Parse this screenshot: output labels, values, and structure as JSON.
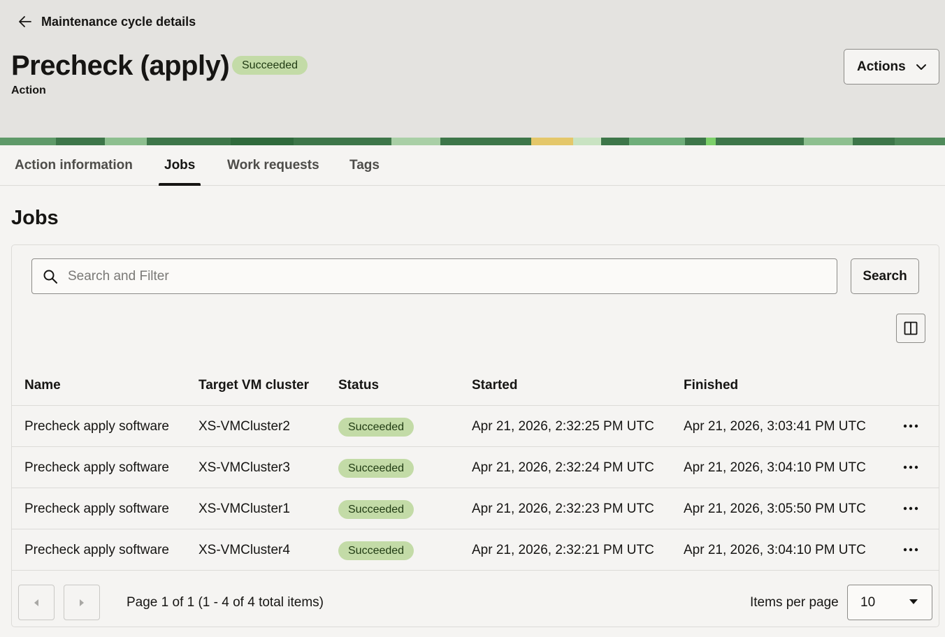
{
  "header": {
    "back_label": "Maintenance cycle details",
    "title": "Precheck (apply)",
    "status": "Succeeded",
    "subtitle": "Action",
    "actions_label": "Actions"
  },
  "tabs": [
    {
      "label": "Action information",
      "active": false
    },
    {
      "label": "Jobs",
      "active": true
    },
    {
      "label": "Work requests",
      "active": false
    },
    {
      "label": "Tags",
      "active": false
    }
  ],
  "section_title": "Jobs",
  "search": {
    "placeholder": "Search and Filter",
    "value": "",
    "button_label": "Search"
  },
  "table": {
    "columns": [
      "Name",
      "Target VM cluster",
      "Status",
      "Started",
      "Finished"
    ],
    "rows": [
      {
        "name": "Precheck apply software",
        "target": "XS-VMCluster2",
        "status": "Succeeded",
        "started": "Apr 21, 2026, 2:32:25 PM UTC",
        "finished": "Apr 21, 2026, 3:03:41 PM UTC"
      },
      {
        "name": "Precheck apply software",
        "target": "XS-VMCluster3",
        "status": "Succeeded",
        "started": "Apr 21, 2026, 2:32:24 PM UTC",
        "finished": "Apr 21, 2026, 3:04:10 PM UTC"
      },
      {
        "name": "Precheck apply software",
        "target": "XS-VMCluster1",
        "status": "Succeeded",
        "started": "Apr 21, 2026, 2:32:23 PM UTC",
        "finished": "Apr 21, 2026, 3:05:50 PM UTC"
      },
      {
        "name": "Precheck apply software",
        "target": "XS-VMCluster4",
        "status": "Succeeded",
        "started": "Apr 21, 2026, 2:32:21 PM UTC",
        "finished": "Apr 21, 2026, 3:04:10 PM UTC"
      }
    ]
  },
  "pagination": {
    "summary": "Page 1 of 1 (1 - 4 of 4 total items)",
    "items_per_page_label": "Items per page",
    "items_per_page_value": "10"
  },
  "icons": {
    "back": "arrow-left-icon",
    "actions_caret": "chevron-down-icon",
    "search": "search-icon",
    "columns": "columns-icon",
    "row_menu": "more-horizontal-icon",
    "prev": "caret-left-icon",
    "next": "caret-right-icon",
    "select_caret": "caret-down-icon"
  },
  "colors": {
    "success_badge_bg": "#c3dba7",
    "success_badge_text": "#1f3a12",
    "header_bg": "#e4e3e0",
    "page_bg": "#f5f4f2"
  }
}
